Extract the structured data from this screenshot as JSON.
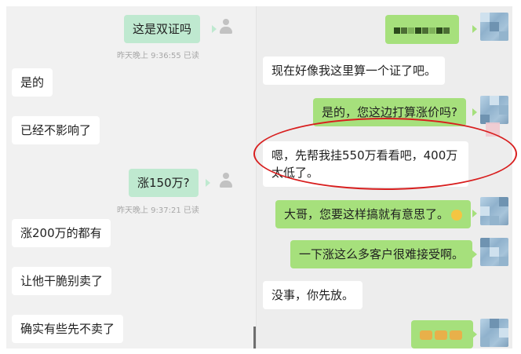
{
  "left_chat": {
    "messages": [
      {
        "text": "这是双证吗"
      },
      {
        "text": "昨天晚上 9:36:55 已读"
      },
      {
        "text": "是的"
      },
      {
        "text": "已经不影响了"
      },
      {
        "text": "涨150万?"
      },
      {
        "text": "昨天晚上 9:37:21 已读"
      },
      {
        "text": "涨200万的都有"
      },
      {
        "text": "让他干脆别卖了"
      },
      {
        "text": "确实有些先不卖了"
      }
    ]
  },
  "right_chat": {
    "messages": [
      {
        "text": "现在好像我这里算一个证了吧。"
      },
      {
        "text": "是的，您这边打算涨价吗?"
      },
      {
        "text": "嗯，先帮我挂550万看看吧，400万太低了。"
      },
      {
        "text": "大哥，您要这样搞就有意思了。"
      },
      {
        "text": "一下涨这么多客户很难接受啊。"
      },
      {
        "text": "没事，你先放。"
      }
    ]
  },
  "colors": {
    "outgoing_bubble_right": "#a6e07c",
    "outgoing_bubble_left": "#bfe9d0",
    "incoming_bubble": "#ffffff",
    "annotation_circle": "#d81e1e"
  }
}
